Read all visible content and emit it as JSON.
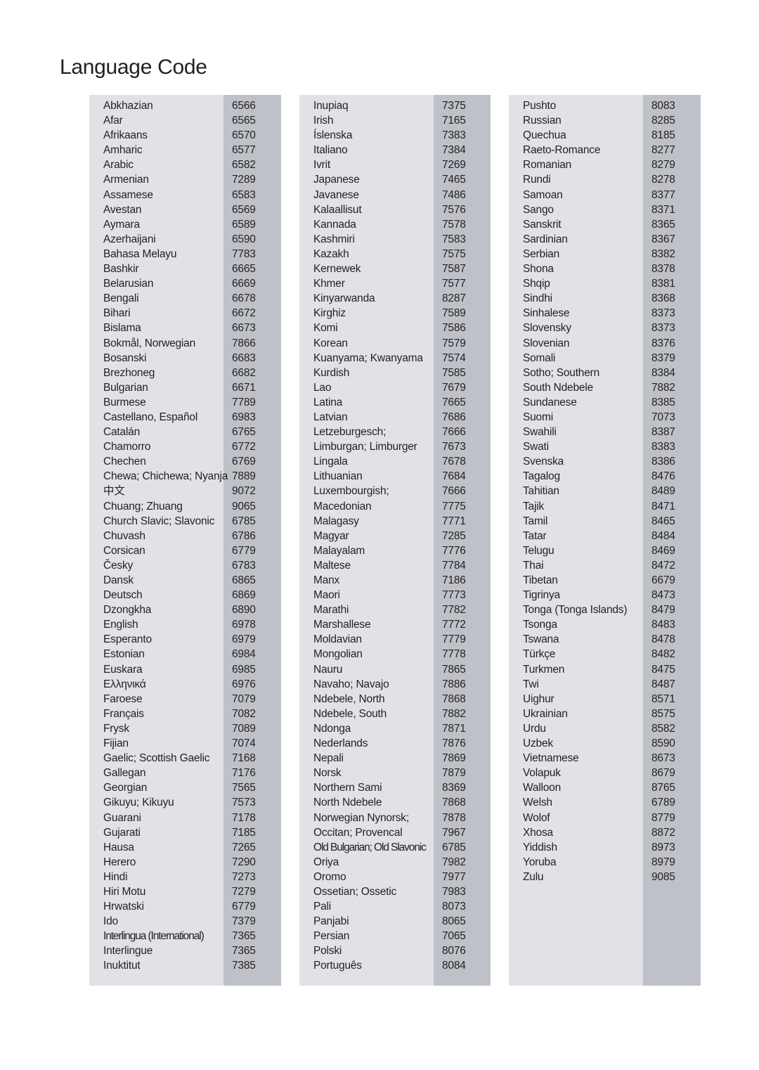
{
  "page": {
    "title": "Language Code",
    "colors": {
      "panel_bg": "#e1e2e6",
      "code_stripe": "#bfc1c8",
      "text": "#231f20"
    }
  },
  "columns": [
    {
      "rows": [
        {
          "language": "Abkhazian",
          "code": "6566"
        },
        {
          "language": "Afar",
          "code": "6565"
        },
        {
          "language": "Afrikaans",
          "code": "6570"
        },
        {
          "language": "Amharic",
          "code": "6577"
        },
        {
          "language": "Arabic",
          "code": "6582"
        },
        {
          "language": "Armenian",
          "code": "7289"
        },
        {
          "language": "Assamese",
          "code": "6583"
        },
        {
          "language": "Avestan",
          "code": "6569"
        },
        {
          "language": "Aymara",
          "code": "6589"
        },
        {
          "language": "Azerhaijani",
          "code": "6590"
        },
        {
          "language": "Bahasa Melayu",
          "code": "7783"
        },
        {
          "language": "Bashkir",
          "code": "6665"
        },
        {
          "language": "Belarusian",
          "code": "6669"
        },
        {
          "language": "Bengali",
          "code": "6678"
        },
        {
          "language": "Bihari",
          "code": "6672"
        },
        {
          "language": "Bislama",
          "code": "6673"
        },
        {
          "language": "Bokmål, Norwegian",
          "code": "7866"
        },
        {
          "language": "Bosanski",
          "code": "6683"
        },
        {
          "language": "Brezhoneg",
          "code": "6682"
        },
        {
          "language": "Bulgarian",
          "code": "6671"
        },
        {
          "language": "Burmese",
          "code": "7789"
        },
        {
          "language": "Castellano, Español",
          "code": "6983"
        },
        {
          "language": "Catalán",
          "code": "6765"
        },
        {
          "language": "Chamorro",
          "code": "6772"
        },
        {
          "language": "Chechen",
          "code": "6769"
        },
        {
          "language": "Chewa; Chichewa; Nyanja",
          "code": "7889"
        },
        {
          "language": "中文",
          "code": "9072"
        },
        {
          "language": "Chuang; Zhuang",
          "code": "9065"
        },
        {
          "language": "Church Slavic; Slavonic",
          "code": "6785"
        },
        {
          "language": "Chuvash",
          "code": "6786"
        },
        {
          "language": "Corsican",
          "code": "6779"
        },
        {
          "language": "Česky",
          "code": "6783"
        },
        {
          "language": "Dansk",
          "code": "6865"
        },
        {
          "language": "Deutsch",
          "code": "6869"
        },
        {
          "language": "Dzongkha",
          "code": "6890"
        },
        {
          "language": "English",
          "code": "6978"
        },
        {
          "language": "Esperanto",
          "code": "6979"
        },
        {
          "language": "Estonian",
          "code": "6984"
        },
        {
          "language": "Euskara",
          "code": "6985"
        },
        {
          "language": "Ελληνικά",
          "code": "6976"
        },
        {
          "language": "Faroese",
          "code": "7079"
        },
        {
          "language": "Français",
          "code": "7082"
        },
        {
          "language": "Frysk",
          "code": "7089"
        },
        {
          "language": "Fijian",
          "code": "7074"
        },
        {
          "language": "Gaelic; Scottish Gaelic",
          "code": "7168"
        },
        {
          "language": "Gallegan",
          "code": "7176"
        },
        {
          "language": "Georgian",
          "code": "7565"
        },
        {
          "language": "Gikuyu; Kikuyu",
          "code": "7573"
        },
        {
          "language": "Guarani",
          "code": "7178"
        },
        {
          "language": "Gujarati",
          "code": "7185"
        },
        {
          "language": "Hausa",
          "code": "7265"
        },
        {
          "language": "Herero",
          "code": "7290"
        },
        {
          "language": "Hindi",
          "code": "7273"
        },
        {
          "language": "Hiri Motu",
          "code": "7279"
        },
        {
          "language": "Hrwatski",
          "code": "6779"
        },
        {
          "language": "Ido",
          "code": "7379"
        },
        {
          "language": "Interlingua (International)",
          "code": "7365"
        },
        {
          "language": "Interlingue",
          "code": "7365"
        },
        {
          "language": "Inuktitut",
          "code": "7385"
        }
      ]
    },
    {
      "rows": [
        {
          "language": "Inupiaq",
          "code": "7375"
        },
        {
          "language": "Irish",
          "code": "7165"
        },
        {
          "language": "Íslenska",
          "code": "7383"
        },
        {
          "language": "Italiano",
          "code": "7384"
        },
        {
          "language": "Ivrit",
          "code": "7269"
        },
        {
          "language": "Japanese",
          "code": "7465"
        },
        {
          "language": "Javanese",
          "code": "7486"
        },
        {
          "language": "Kalaallisut",
          "code": "7576"
        },
        {
          "language": "Kannada",
          "code": "7578"
        },
        {
          "language": "Kashmiri",
          "code": "7583"
        },
        {
          "language": "Kazakh",
          "code": "7575"
        },
        {
          "language": "Kernewek",
          "code": "7587"
        },
        {
          "language": "Khmer",
          "code": "7577"
        },
        {
          "language": "Kinyarwanda",
          "code": "8287"
        },
        {
          "language": "Kirghiz",
          "code": "7589"
        },
        {
          "language": "Komi",
          "code": "7586"
        },
        {
          "language": "Korean",
          "code": "7579"
        },
        {
          "language": "Kuanyama; Kwanyama",
          "code": "7574"
        },
        {
          "language": "Kurdish",
          "code": "7585"
        },
        {
          "language": "Lao",
          "code": "7679"
        },
        {
          "language": "Latina",
          "code": "7665"
        },
        {
          "language": "Latvian",
          "code": "7686"
        },
        {
          "language": "Letzeburgesch;",
          "code": "7666"
        },
        {
          "language": "Limburgan; Limburger",
          "code": "7673"
        },
        {
          "language": "Lingala",
          "code": "7678"
        },
        {
          "language": "Lithuanian",
          "code": "7684"
        },
        {
          "language": "Luxembourgish;",
          "code": "7666"
        },
        {
          "language": "Macedonian",
          "code": "7775"
        },
        {
          "language": "Malagasy",
          "code": "7771"
        },
        {
          "language": "Magyar",
          "code": "7285"
        },
        {
          "language": "Malayalam",
          "code": "7776"
        },
        {
          "language": "Maltese",
          "code": "7784"
        },
        {
          "language": "Manx",
          "code": "7186"
        },
        {
          "language": "Maori",
          "code": "7773"
        },
        {
          "language": "Marathi",
          "code": "7782"
        },
        {
          "language": "Marshallese",
          "code": "7772"
        },
        {
          "language": "Moldavian",
          "code": "7779"
        },
        {
          "language": "Mongolian",
          "code": "7778"
        },
        {
          "language": "Nauru",
          "code": "7865"
        },
        {
          "language": "Navaho; Navajo",
          "code": "7886"
        },
        {
          "language": "Ndebele, North",
          "code": "7868"
        },
        {
          "language": "Ndebele, South",
          "code": "7882"
        },
        {
          "language": "Ndonga",
          "code": "7871"
        },
        {
          "language": "Nederlands",
          "code": "7876"
        },
        {
          "language": "Nepali",
          "code": "7869"
        },
        {
          "language": "Norsk",
          "code": "7879"
        },
        {
          "language": "Northern Sami",
          "code": "8369"
        },
        {
          "language": "North Ndebele",
          "code": "7868"
        },
        {
          "language": "Norwegian Nynorsk;",
          "code": "7878"
        },
        {
          "language": "Occitan; Provencal",
          "code": "7967"
        },
        {
          "language": "Old Bulgarian; Old Slavonic",
          "code": "6785"
        },
        {
          "language": "Oriya",
          "code": "7982"
        },
        {
          "language": "Oromo",
          "code": "7977"
        },
        {
          "language": "Ossetian; Ossetic",
          "code": "7983"
        },
        {
          "language": "Pali",
          "code": "8073"
        },
        {
          "language": "Panjabi",
          "code": "8065"
        },
        {
          "language": "Persian",
          "code": "7065"
        },
        {
          "language": "Polski",
          "code": "8076"
        },
        {
          "language": "Português",
          "code": "8084"
        }
      ]
    },
    {
      "rows": [
        {
          "language": "Pushto",
          "code": "8083"
        },
        {
          "language": "Russian",
          "code": "8285"
        },
        {
          "language": "Quechua",
          "code": "8185"
        },
        {
          "language": "Raeto-Romance",
          "code": "8277"
        },
        {
          "language": "Romanian",
          "code": "8279"
        },
        {
          "language": "Rundi",
          "code": "8278"
        },
        {
          "language": "Samoan",
          "code": "8377"
        },
        {
          "language": "Sango",
          "code": "8371"
        },
        {
          "language": "Sanskrit",
          "code": "8365"
        },
        {
          "language": "Sardinian",
          "code": "8367"
        },
        {
          "language": "Serbian",
          "code": "8382"
        },
        {
          "language": "Shona",
          "code": "8378"
        },
        {
          "language": "Shqip",
          "code": "8381"
        },
        {
          "language": "Sindhi",
          "code": "8368"
        },
        {
          "language": "Sinhalese",
          "code": "8373"
        },
        {
          "language": "Slovensky",
          "code": "8373"
        },
        {
          "language": "Slovenian",
          "code": "8376"
        },
        {
          "language": "Somali",
          "code": "8379"
        },
        {
          "language": "Sotho; Southern",
          "code": "8384"
        },
        {
          "language": "South Ndebele",
          "code": "7882"
        },
        {
          "language": "Sundanese",
          "code": "8385"
        },
        {
          "language": "Suomi",
          "code": "7073"
        },
        {
          "language": "Swahili",
          "code": "8387"
        },
        {
          "language": "Swati",
          "code": "8383"
        },
        {
          "language": "Svenska",
          "code": "8386"
        },
        {
          "language": "Tagalog",
          "code": "8476"
        },
        {
          "language": "Tahitian",
          "code": "8489"
        },
        {
          "language": "Tajik",
          "code": "8471"
        },
        {
          "language": "Tamil",
          "code": "8465"
        },
        {
          "language": "Tatar",
          "code": "8484"
        },
        {
          "language": "Telugu",
          "code": "8469"
        },
        {
          "language": "Thai",
          "code": "8472"
        },
        {
          "language": "Tibetan",
          "code": "6679"
        },
        {
          "language": "Tigrinya",
          "code": "8473"
        },
        {
          "language": "Tonga (Tonga Islands)",
          "code": "8479"
        },
        {
          "language": "Tsonga",
          "code": "8483"
        },
        {
          "language": "Tswana",
          "code": "8478"
        },
        {
          "language": "Türkçe",
          "code": "8482"
        },
        {
          "language": "Turkmen",
          "code": "8475"
        },
        {
          "language": "Twi",
          "code": "8487"
        },
        {
          "language": "Uighur",
          "code": "8571"
        },
        {
          "language": "Ukrainian",
          "code": "8575"
        },
        {
          "language": "Urdu",
          "code": "8582"
        },
        {
          "language": "Uzbek",
          "code": "8590"
        },
        {
          "language": "Vietnamese",
          "code": "8673"
        },
        {
          "language": "Volapuk",
          "code": "8679"
        },
        {
          "language": "Walloon",
          "code": "8765"
        },
        {
          "language": "Welsh",
          "code": "6789"
        },
        {
          "language": "Wolof",
          "code": "8779"
        },
        {
          "language": "Xhosa",
          "code": "8872"
        },
        {
          "language": "Yiddish",
          "code": "8973"
        },
        {
          "language": "Yoruba",
          "code": "8979"
        },
        {
          "language": "Zulu",
          "code": "9085"
        }
      ]
    }
  ]
}
